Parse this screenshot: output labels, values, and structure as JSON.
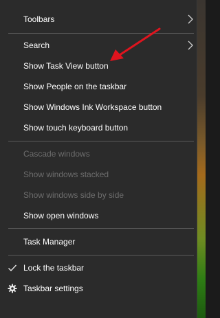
{
  "menu": {
    "items": [
      {
        "label": "Toolbars",
        "enabled": true,
        "submenu": true
      },
      {
        "label": "Search",
        "enabled": true,
        "submenu": true
      },
      {
        "label": "Show Task View button",
        "enabled": true
      },
      {
        "label": "Show People on the taskbar",
        "enabled": true
      },
      {
        "label": "Show Windows Ink Workspace button",
        "enabled": true
      },
      {
        "label": "Show touch keyboard button",
        "enabled": true
      },
      {
        "label": "Cascade windows",
        "enabled": false
      },
      {
        "label": "Show windows stacked",
        "enabled": false
      },
      {
        "label": "Show windows side by side",
        "enabled": false
      },
      {
        "label": "Show open windows",
        "enabled": true
      },
      {
        "label": "Task Manager",
        "enabled": true
      },
      {
        "label": "Lock the taskbar",
        "enabled": true,
        "checked": true,
        "icon": "checkmark-icon"
      },
      {
        "label": "Taskbar settings",
        "enabled": true,
        "icon": "gear-icon"
      }
    ]
  },
  "colors": {
    "menu_bg": "#2b2b2b",
    "text": "#ffffff",
    "disabled_text": "#6d6d6d",
    "separator": "#5b5b5b",
    "annotation_arrow": "#e0141e"
  }
}
